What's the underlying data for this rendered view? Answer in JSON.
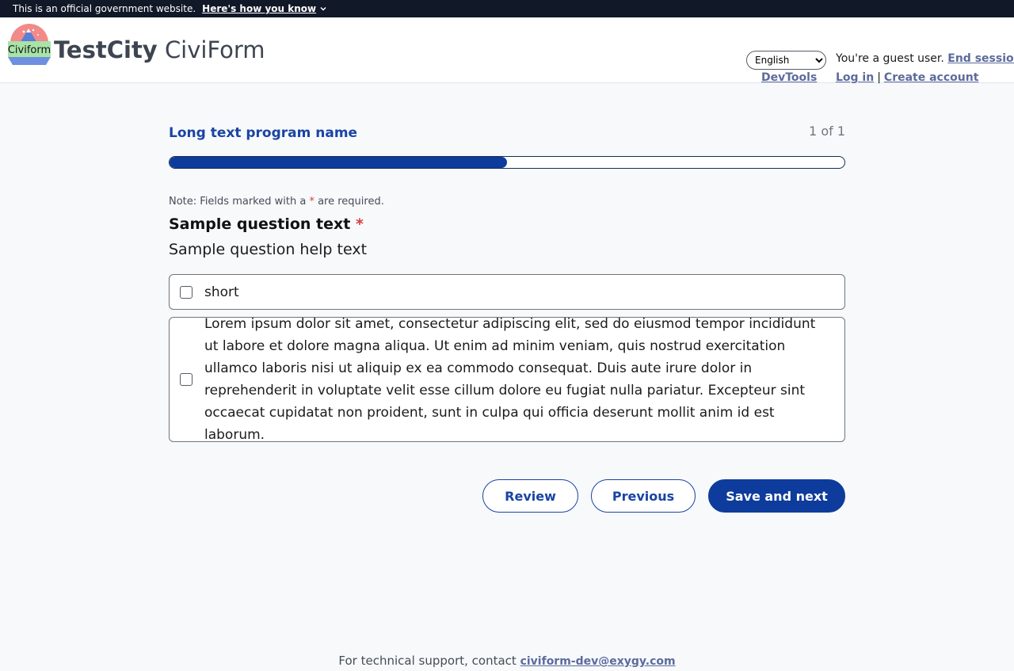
{
  "gov_banner": {
    "text": "This is an official government website.",
    "link": "Here's how you know"
  },
  "header": {
    "logo_text": "Civiform",
    "brand_city": "TestCity",
    "brand_app": "CiviForm",
    "language_selected": "English",
    "devtools": "DevTools",
    "guest_text": "You're a guest user.",
    "end_session": "End session",
    "login": "Log in",
    "separator": "|",
    "create_account": "Create account"
  },
  "program": {
    "name": "Long text program name",
    "count": "1 of 1",
    "progress_fraction": 0.5
  },
  "form": {
    "note_prefix": "Note: Fields marked with a",
    "note_star": "*",
    "note_suffix": "are required.",
    "question_text": "Sample question text",
    "question_star": "*",
    "help_text": "Sample question help text",
    "options": [
      {
        "label": "short"
      },
      {
        "label": "Lorem ipsum dolor sit amet, consectetur adipiscing elit, sed do eiusmod tempor incididunt ut labore et dolore magna aliqua. Ut enim ad minim veniam, quis nostrud exercitation ullamco laboris nisi ut aliquip ex ea commodo consequat. Duis aute irure dolor in reprehenderit in voluptate velit esse cillum dolore eu fugiat nulla pariatur. Excepteur sint occaecat cupidatat non proident, sunt in culpa qui officia deserunt mollit anim id est laborum."
      }
    ]
  },
  "buttons": {
    "review": "Review",
    "previous": "Previous",
    "save_next": "Save and next"
  },
  "footer": {
    "text": "For technical support, contact",
    "email": "civiform-dev@exygy.com"
  }
}
